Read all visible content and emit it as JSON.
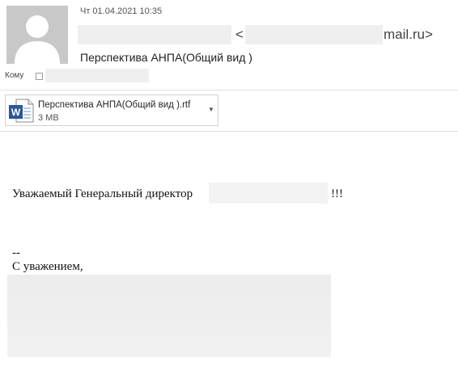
{
  "header": {
    "date": "Чт 01.04.2021 10:35",
    "sender_open_bracket": "<",
    "sender_domain": "mail.ru>",
    "subject": "Перспектива АНПА(Общий вид )",
    "to_label": "Кому"
  },
  "attachment": {
    "file_name": "Перспектива АНПА(Общий вид ).rtf",
    "file_size": "3 MB",
    "icon": "word-document-icon"
  },
  "body": {
    "greeting": "Уважаемый Генеральный директор",
    "exclamation": "!!!",
    "dashes": "--",
    "regards": "С уважением,"
  },
  "colors": {
    "avatar_bg": "#c8c8c8",
    "word_blue": "#2b579a",
    "redaction": "#efefef"
  }
}
